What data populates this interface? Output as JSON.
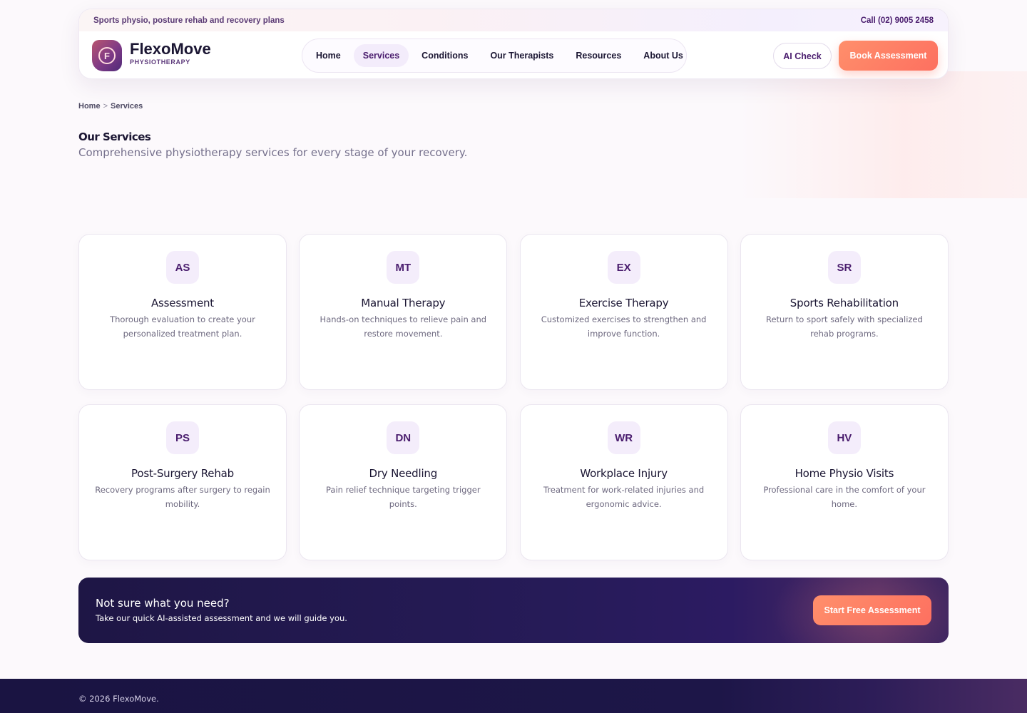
{
  "topbar": {
    "tagline": "Sports physio, posture rehab and recovery plans",
    "phone": "Call (02) 9005 2458"
  },
  "brand": {
    "logo_letter": "F",
    "name": "FlexoMove",
    "subtitle": "PHYSIOTHERAPY"
  },
  "nav": {
    "items": [
      {
        "label": "Home"
      },
      {
        "label": "Services"
      },
      {
        "label": "Conditions"
      },
      {
        "label": "Our Therapists"
      },
      {
        "label": "Resources"
      },
      {
        "label": "About Us"
      }
    ],
    "active": "Services"
  },
  "header_actions": {
    "ai_check": "AI Check",
    "book": "Book Assessment"
  },
  "breadcrumb": {
    "home": "Home",
    "separator": ">",
    "current": "Services"
  },
  "page": {
    "title": "Our Services",
    "subtitle": "Comprehensive physiotherapy services for every stage of your recovery."
  },
  "services": [
    {
      "badge": "AS",
      "title": "Assessment",
      "desc": "Thorough evaluation to create your personalized treatment plan."
    },
    {
      "badge": "MT",
      "title": "Manual Therapy",
      "desc": "Hands-on techniques to relieve pain and restore movement."
    },
    {
      "badge": "EX",
      "title": "Exercise Therapy",
      "desc": "Customized exercises to strengthen and improve function."
    },
    {
      "badge": "SR",
      "title": "Sports Rehabilitation",
      "desc": "Return to sport safely with specialized rehab programs."
    },
    {
      "badge": "PS",
      "title": "Post-Surgery Rehab",
      "desc": "Recovery programs after surgery to regain mobility."
    },
    {
      "badge": "DN",
      "title": "Dry Needling",
      "desc": "Pain relief technique targeting trigger points."
    },
    {
      "badge": "WR",
      "title": "Workplace Injury",
      "desc": "Treatment for work-related injuries and ergonomic advice."
    },
    {
      "badge": "HV",
      "title": "Home Physio Visits",
      "desc": "Professional care in the comfort of your home."
    }
  ],
  "cta": {
    "heading": "Not sure what you need?",
    "text": "Take our quick AI-assisted assessment and we will guide you.",
    "button": "Start Free Assessment"
  },
  "footer": {
    "copyright": "© 2026 FlexoMove."
  },
  "colors": {
    "brand_purple": "#4a1d6e",
    "accent_coral": "#fd7060",
    "navy": "#1e1645"
  }
}
